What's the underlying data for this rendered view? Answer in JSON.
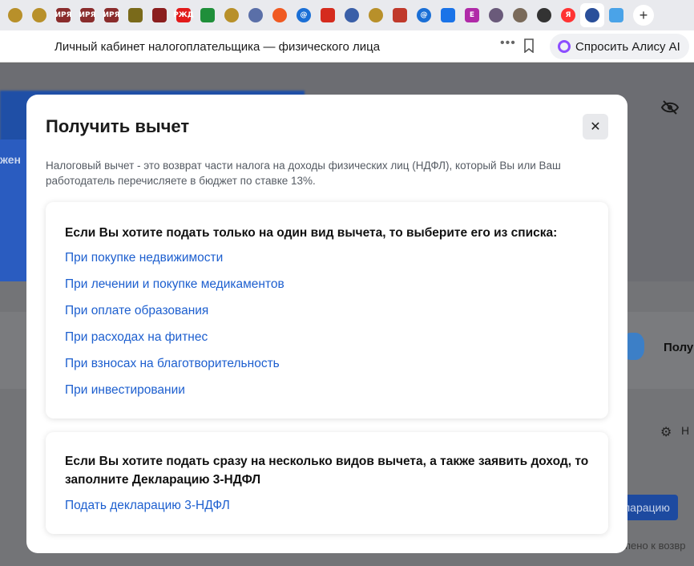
{
  "browser": {
    "tabs": [
      {
        "icon": "emblem-icon",
        "label": "",
        "color": "#b8902a"
      },
      {
        "icon": "emblem-icon",
        "label": "",
        "color": "#b8902a"
      },
      {
        "icon": "mirea-icon",
        "label": "ИРЯ",
        "color": "#8a2c2c"
      },
      {
        "icon": "mirea-icon",
        "label": "ИРЯ",
        "color": "#8a2c2c"
      },
      {
        "icon": "mirea-icon",
        "label": "ИРЯ",
        "color": "#8a2c2c"
      },
      {
        "icon": "eagle-icon",
        "label": "",
        "color": "#7a6a1a"
      },
      {
        "icon": "museum-icon",
        "label": "",
        "color": "#8b1e1e"
      },
      {
        "icon": "rzd-icon",
        "label": "РЖД",
        "color": "#e21a1a"
      },
      {
        "icon": "leaf-icon",
        "label": "",
        "color": "#1f8f3a"
      },
      {
        "icon": "emblem-icon",
        "label": "",
        "color": "#b8902a"
      },
      {
        "icon": "avatar-icon",
        "label": "",
        "color": "#5a6fa8"
      },
      {
        "icon": "flower-icon",
        "label": "",
        "color": "#f05a22"
      },
      {
        "icon": "at-icon",
        "label": "@",
        "color": "#1a6fd6"
      },
      {
        "icon": "flag-icon",
        "label": "",
        "color": "#d52b1e"
      },
      {
        "icon": "fns-icon",
        "label": "",
        "color": "#3a5fa8"
      },
      {
        "icon": "emblem-icon",
        "label": "",
        "color": "#b8902a"
      },
      {
        "icon": "shield-icon",
        "label": "",
        "color": "#c0392b"
      },
      {
        "icon": "at-icon",
        "label": "@",
        "color": "#1a6fd6"
      },
      {
        "icon": "mail-icon",
        "label": "",
        "color": "#1a73e8"
      },
      {
        "icon": "e-icon",
        "label": "E",
        "color": "#b02aa8"
      },
      {
        "icon": "avatar-icon",
        "label": "",
        "color": "#6a5a7a"
      },
      {
        "icon": "avatar-icon",
        "label": "",
        "color": "#7a6a5a"
      },
      {
        "icon": "alice-icon",
        "label": "",
        "color": "#333333"
      },
      {
        "icon": "yandex-icon",
        "label": "Я",
        "color": "#ff3333"
      },
      {
        "icon": "fns-icon",
        "label": "",
        "color": "#2a4f9a"
      },
      {
        "icon": "chart-icon",
        "label": "",
        "color": "#4aa3e8"
      }
    ],
    "page_title": "Личный кабинет налогоплательщика — физического лица",
    "alice_button": "Спросить Алису AI"
  },
  "background": {
    "hero_fragment": "жен",
    "side_label": "Полу",
    "button_fragment": "ларацию",
    "settings_fragment": "Н",
    "footer_fragment": "пено к возвр"
  },
  "modal": {
    "title": "Получить вычет",
    "description": "Налоговый вычет - это возврат части налога на доходы физических лиц (НДФЛ), который Вы или Ваш работодатель перечисляете в бюджет по ставке 13%.",
    "single": {
      "heading": "Если Вы хотите подать только на один вид вычета, то выберите его из списка:",
      "links": [
        "При покупке недвижимости",
        "При лечении и покупке медикаментов",
        "При оплате образования",
        "При расходах на фитнес",
        "При взносах на благотворительность",
        "При инвестировании"
      ]
    },
    "multiple": {
      "heading": "Если Вы хотите подать сразу на несколько видов вычета, а также заявить доход, то заполните Декларацию 3-НДФЛ",
      "link": "Подать декларацию 3-НДФЛ"
    }
  },
  "colors": {
    "link": "#1d5fcf",
    "overlay": "#6f7073",
    "accent_blue": "#1f4fa6"
  }
}
